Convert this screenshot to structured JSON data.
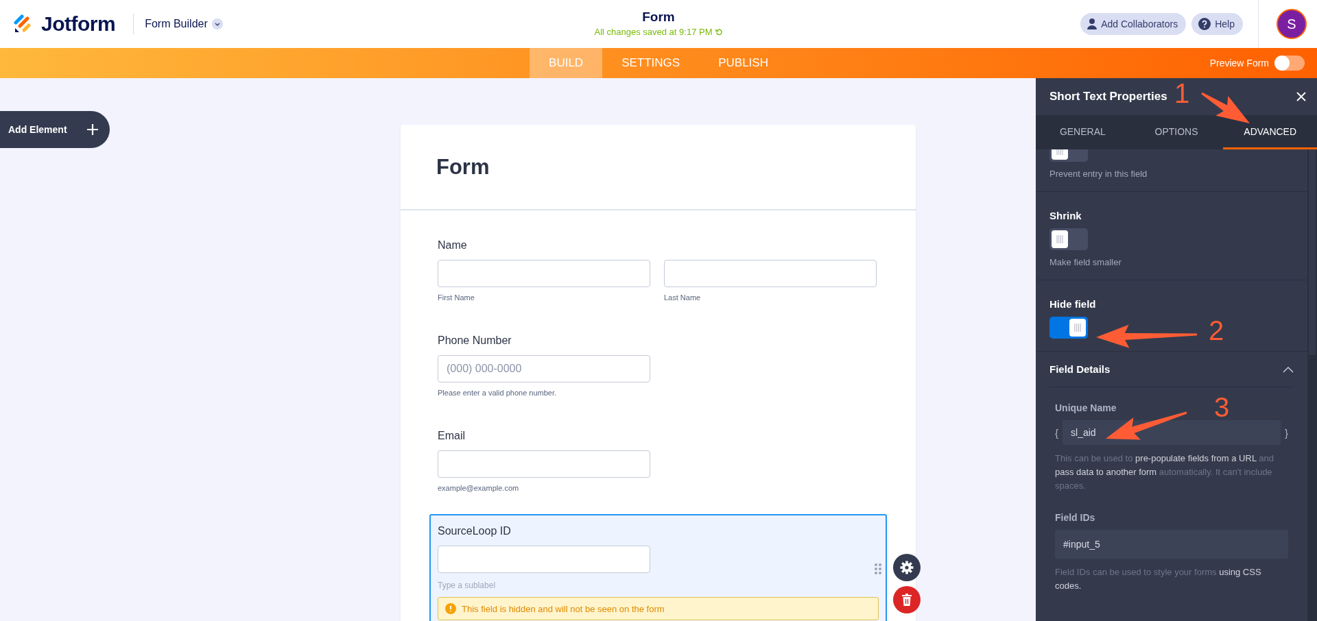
{
  "header": {
    "logo": "Jotform",
    "product": "Form Builder",
    "title": "Form",
    "saved": "All changes saved at 9:17 PM",
    "buttons": [
      {
        "kind": "collab",
        "label": "Add Collaborators"
      },
      {
        "kind": "help",
        "label": "Help"
      }
    ],
    "avatar": "S"
  },
  "nav": {
    "tabs": [
      {
        "label": "BUILD",
        "selected": true
      },
      {
        "label": "SETTINGS",
        "selected": false
      },
      {
        "label": "PUBLISH",
        "selected": false
      }
    ],
    "preview": {
      "label": "Preview Form",
      "on": false
    }
  },
  "add_element": "Add Element",
  "form": {
    "title": "Form",
    "fields": [
      {
        "kind": "name",
        "label": "Name",
        "sublabels": [
          "First Name",
          "Last Name"
        ],
        "selected": false
      },
      {
        "kind": "text",
        "label": "Phone Number",
        "placeholder": "(000) 000-0000",
        "sublabel": "Please enter a valid phone number.",
        "selected": false
      },
      {
        "kind": "text",
        "label": "Email",
        "sublabel": "example@example.com",
        "selected": false
      },
      {
        "kind": "text",
        "label": "SourceLoop ID",
        "sublabel_placeholder": "Type a sublabel",
        "warning": "This field is hidden and will not be seen on the form",
        "selected": true
      }
    ]
  },
  "panel": {
    "title": "Short Text Properties",
    "tabs": [
      {
        "label": "GENERAL",
        "selected": false
      },
      {
        "label": "OPTIONS",
        "selected": false
      },
      {
        "label": "ADVANCED",
        "selected": true
      }
    ],
    "toggles": [
      {
        "description": "Prevent entry in this field",
        "on": false
      },
      {
        "label": "Shrink",
        "description": "Make field smaller",
        "on": false
      },
      {
        "label": "Hide field",
        "on": true
      }
    ],
    "field_details": {
      "title": "Field Details",
      "expanded": true,
      "unique_name": {
        "label": "Unique Name",
        "open_brace": "{",
        "value": "sl_aid",
        "close_brace": "}",
        "help": "This can be used to **pre-populate fields from a URL** and **pass data to another form** automatically. It can't include spaces."
      },
      "field_ids": {
        "label": "Field IDs",
        "value": "#input_5",
        "help": "Field IDs can be used to style your forms **using CSS codes.**"
      }
    }
  },
  "annotations": [
    {
      "label": "1"
    },
    {
      "label": "2"
    },
    {
      "label": "3"
    }
  ]
}
